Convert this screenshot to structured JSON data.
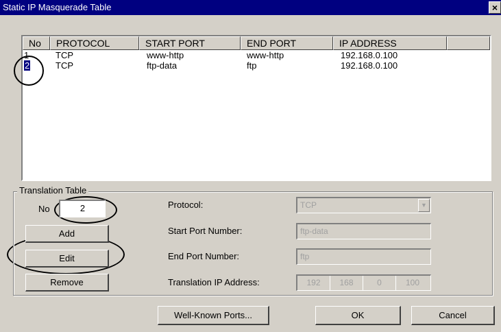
{
  "window": {
    "title": "Static IP Masquerade Table",
    "close_glyph": "×"
  },
  "table": {
    "columns": [
      "No",
      "PROTOCOL",
      "START PORT",
      "END PORT",
      "IP ADDRESS",
      ""
    ],
    "rows": [
      {
        "no": "1",
        "protocol": "TCP",
        "start_port": "www-http",
        "end_port": "www-http",
        "ip": "192.168.0.100"
      },
      {
        "no": "2",
        "protocol": "TCP",
        "start_port": "ftp-data",
        "end_port": "ftp",
        "ip": "192.168.0.100"
      }
    ]
  },
  "translation": {
    "group_label": "Translation Table",
    "no_label": "No",
    "no_value": "2",
    "add_label": "Add",
    "edit_label": "Edit",
    "remove_label": "Remove",
    "protocol_label": "Protocol:",
    "protocol_value": "TCP",
    "start_port_label": "Start Port Number:",
    "start_port_value": "ftp-data",
    "end_port_label": "End Port Number:",
    "end_port_value": "ftp",
    "ip_label": "Translation IP Address:",
    "ip_octets": [
      "192",
      "168",
      "0",
      "100"
    ]
  },
  "footer": {
    "well_known_label": "Well-Known Ports...",
    "ok_label": "OK",
    "cancel_label": "Cancel"
  }
}
